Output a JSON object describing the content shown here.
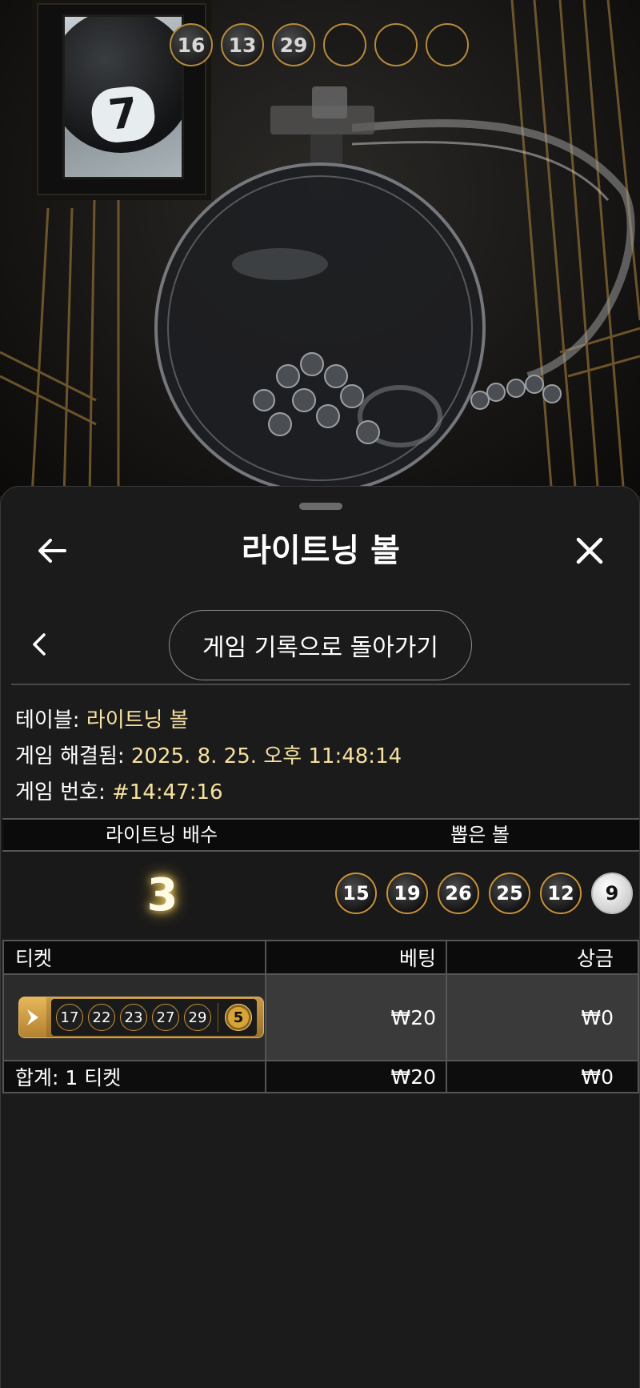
{
  "stage": {
    "drawn_balls": [
      "16",
      "13",
      "29",
      "",
      "",
      ""
    ],
    "frame_ball_number": "7"
  },
  "sheet": {
    "title": "라이트닝 볼",
    "back_icon": "arrow-left-icon",
    "close_icon": "close-icon"
  },
  "history": {
    "button_label": "게임 기록으로 돌아가기",
    "prev_icon": "chevron-left-icon"
  },
  "info": {
    "table_label": "테이블:",
    "table_value": "라이트닝 볼",
    "resolved_label": "게임 해결됨:",
    "resolved_value": "2025. 8. 25. 오후 11:48:14",
    "game_no_label": "게임 번호:",
    "game_no_value": "#14:47:16"
  },
  "result": {
    "multiplier_header": "라이트닝 배수",
    "picked_header": "뽑은 볼",
    "multiplier": "3",
    "picked_balls": [
      "15",
      "19",
      "26",
      "25",
      "12",
      "9"
    ]
  },
  "tickets": {
    "headers": [
      "티켓",
      "베팅",
      "상금"
    ],
    "rows": [
      {
        "numbers": [
          "17",
          "22",
          "23",
          "27",
          "29"
        ],
        "bonus": "5",
        "bet": "₩20",
        "win": "₩0"
      }
    ],
    "total_label": "합계: 1 티켓",
    "total_bet": "₩20",
    "total_win": "₩0"
  },
  "colors": {
    "accent_gold": "#c8923a",
    "info_value": "#f6e1a0",
    "sheet_bg": "#1b1b1b"
  }
}
